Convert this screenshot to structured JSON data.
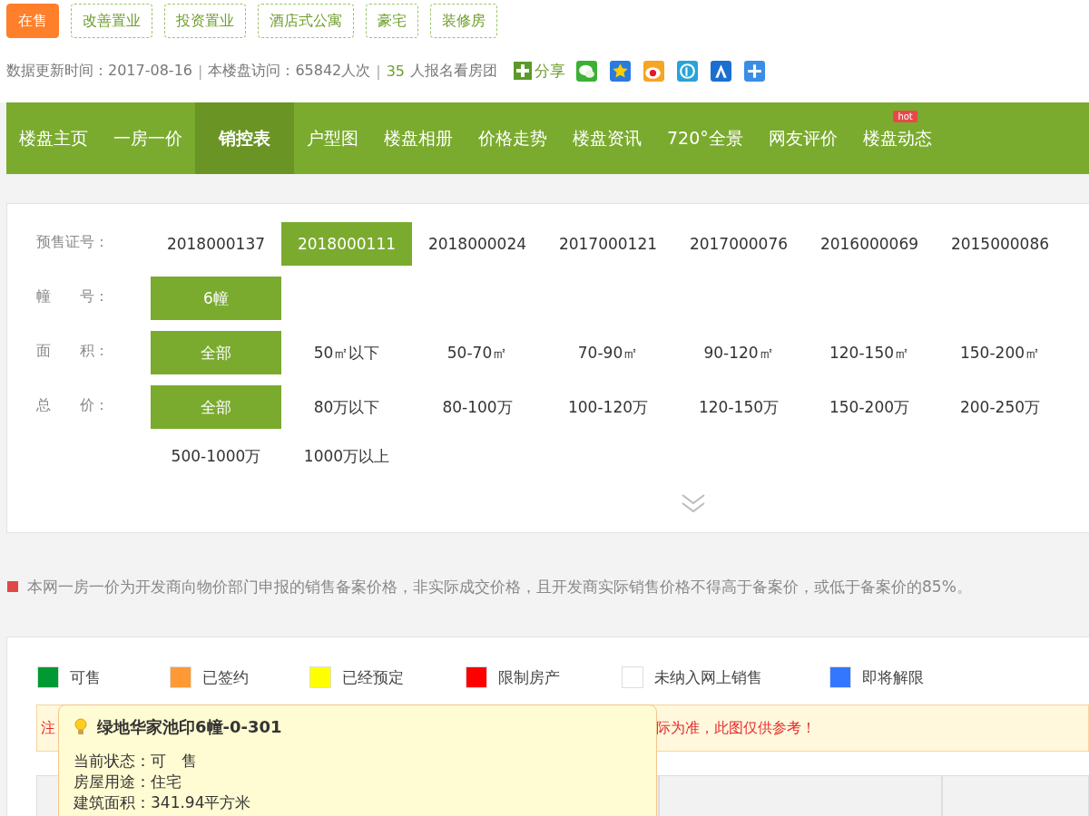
{
  "tags": [
    {
      "label": "在售",
      "selected": true
    },
    {
      "label": "改善置业",
      "selected": false
    },
    {
      "label": "投资置业",
      "selected": false
    },
    {
      "label": "酒店式公寓",
      "selected": false
    },
    {
      "label": "豪宅",
      "selected": false
    },
    {
      "label": "装修房",
      "selected": false
    }
  ],
  "meta": {
    "update": "数据更新时间：2017-08-16",
    "separators": [
      "|",
      "|"
    ],
    "visits": "本楼盘访问：65842人次",
    "signup_count": "35",
    "signup_text": "人报名看房团",
    "share": "分享"
  },
  "nav": [
    {
      "label": "楼盘主页",
      "selected": false
    },
    {
      "label": "一房一价",
      "selected": false
    },
    {
      "label": "销控表",
      "selected": true
    },
    {
      "label": "户型图",
      "selected": false
    },
    {
      "label": "楼盘相册",
      "selected": false
    },
    {
      "label": "价格走势",
      "selected": false
    },
    {
      "label": "楼盘资讯",
      "selected": false
    },
    {
      "label": "720°全景",
      "selected": false
    },
    {
      "label": "网友评价",
      "selected": false
    },
    {
      "label": "楼盘动态",
      "selected": false,
      "badge": "hot"
    }
  ],
  "filters": [
    {
      "label": "预售证号：",
      "options": [
        {
          "label": "2018000137",
          "selected": false
        },
        {
          "label": "2018000111",
          "selected": true
        },
        {
          "label": "2018000024",
          "selected": false
        },
        {
          "label": "2017000121",
          "selected": false
        },
        {
          "label": "2017000076",
          "selected": false
        },
        {
          "label": "2016000069",
          "selected": false
        },
        {
          "label": "2015000086",
          "selected": false
        }
      ]
    },
    {
      "label": "幢　　号：",
      "options": [
        {
          "label": "6幢",
          "selected": true
        }
      ]
    },
    {
      "label": "面　　积：",
      "options": [
        {
          "label": "全部",
          "selected": true
        },
        {
          "label": "50㎡以下",
          "selected": false
        },
        {
          "label": "50-70㎡",
          "selected": false
        },
        {
          "label": "70-90㎡",
          "selected": false
        },
        {
          "label": "90-120㎡",
          "selected": false
        },
        {
          "label": "120-150㎡",
          "selected": false
        },
        {
          "label": "150-200㎡",
          "selected": false
        }
      ]
    },
    {
      "label": "总　　价：",
      "options": [
        {
          "label": "全部",
          "selected": true
        },
        {
          "label": "80万以下",
          "selected": false
        },
        {
          "label": "80-100万",
          "selected": false
        },
        {
          "label": "100-120万",
          "selected": false
        },
        {
          "label": "120-150万",
          "selected": false
        },
        {
          "label": "150-200万",
          "selected": false
        },
        {
          "label": "200-250万",
          "selected": false
        },
        {
          "label": "500-1000万",
          "selected": false
        },
        {
          "label": "1000万以上",
          "selected": false
        }
      ]
    }
  ],
  "notice": "本网一房一价为开发商向物价部门申报的销售备案价格，非实际成交价格，且开发商实际销售价格不得高于备案价，或低于备案价的85%。",
  "legend": [
    {
      "label": "可售",
      "color": "#009933"
    },
    {
      "label": "已签约",
      "color": "#ff9933"
    },
    {
      "label": "已经预定",
      "color": "#ffff00"
    },
    {
      "label": "限制房产",
      "color": "#ff0000"
    },
    {
      "label": "未纳入网上销售",
      "color": "#ffffff"
    },
    {
      "label": "即将解限",
      "color": "#3377ff"
    }
  ],
  "warning": {
    "start": "注",
    "end": "际为准，此图仅供参考！"
  },
  "tooltip": {
    "title": "绿地华家池印6幢-0-301",
    "lines": [
      "当前状态：可　售",
      "房屋用途：住宅",
      "建筑面积：341.94平方米"
    ]
  }
}
